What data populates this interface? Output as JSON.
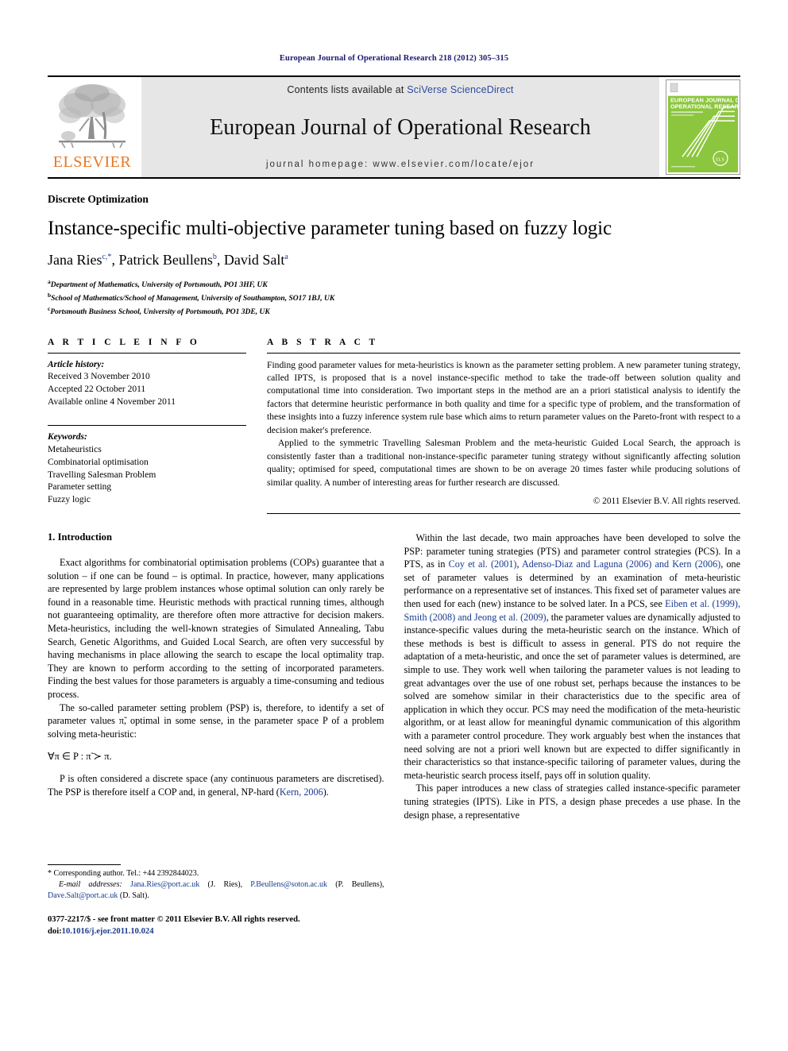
{
  "running_head": "European Journal of Operational Research 218 (2012) 305–315",
  "masthead": {
    "publisher_name": "ELSEVIER",
    "contents_prefix": "Contents lists available at ",
    "contents_link": "SciVerse ScienceDirect",
    "journal_title": "European Journal of Operational Research",
    "homepage": "journal homepage: www.elsevier.com/locate/ejor",
    "cover_title_line1": "EUROPEAN JOURNAL OF",
    "cover_title_line2": "OPERATIONAL RESEARCH",
    "cover_logo": "ELSEVIER",
    "accent_orange": "#E87722",
    "cover_green": "#8cc63e",
    "link_blue": "#2e4a9e"
  },
  "article": {
    "section_label": "Discrete Optimization",
    "title": "Instance-specific multi-objective parameter tuning based on fuzzy logic",
    "authors": [
      {
        "name": "Jana Ries",
        "marker": "c,*"
      },
      {
        "name": "Patrick Beullens",
        "marker": "b"
      },
      {
        "name": "David Salt",
        "marker": "a"
      }
    ],
    "affiliations": [
      {
        "marker": "a",
        "text": "Department of Mathematics, University of Portsmouth, PO1 3HF, UK"
      },
      {
        "marker": "b",
        "text": "School of Mathematics/School of Management, University of Southampton, SO17 1BJ, UK"
      },
      {
        "marker": "c",
        "text": "Portsmouth Business School, University of Portsmouth, PO1 3DE, UK"
      }
    ]
  },
  "article_info": {
    "heading": "A R T I C L E   I N F O",
    "history_label": "Article history:",
    "history": [
      "Received 3 November 2010",
      "Accepted 22 October 2011",
      "Available online 4 November 2011"
    ],
    "keywords_label": "Keywords:",
    "keywords": [
      "Metaheuristics",
      "Combinatorial optimisation",
      "Travelling Salesman Problem",
      "Parameter setting",
      "Fuzzy logic"
    ]
  },
  "abstract": {
    "heading": "A B S T R A C T",
    "paragraphs": [
      "Finding good parameter values for meta-heuristics is known as the parameter setting problem. A new parameter tuning strategy, called IPTS, is proposed that is a novel instance-specific method to take the trade-off between solution quality and computational time into consideration. Two important steps in the method are an a priori statistical analysis to identify the factors that determine heuristic performance in both quality and time for a specific type of problem, and the transformation of these insights into a fuzzy inference system rule base which aims to return parameter values on the Pareto-front with respect to a decision maker's preference.",
      "Applied to the symmetric Travelling Salesman Problem and the meta-heuristic Guided Local Search, the approach is consistently faster than a traditional non-instance-specific parameter tuning strategy without significantly affecting solution quality; optimised for speed, computational times are shown to be on average 20 times faster while producing solutions of similar quality. A number of interesting areas for further research are discussed."
    ],
    "copyright": "© 2011 Elsevier B.V. All rights reserved."
  },
  "introduction": {
    "heading": "1. Introduction",
    "left_paragraphs": [
      "Exact algorithms for combinatorial optimisation problems (COPs) guarantee that a solution – if one can be found – is optimal. In practice, however, many applications are represented by large problem instances whose optimal solution can only rarely be found in a reasonable time. Heuristic methods with practical running times, although not guaranteeing optimality, are therefore often more attractive for decision makers. Meta-heuristics, including the well-known strategies of Simulated Annealing, Tabu Search, Genetic Algorithms, and Guided Local Search, are often very successful by having mechanisms in place allowing the search to escape the local optimality trap. They are known to perform according to the setting of incorporated parameters. Finding the best values for those parameters is arguably a time-consuming and tedious process.",
      "The so-called parameter setting problem (PSP) is, therefore, to identify a set of parameter values π̃, optimal in some sense, in the parameter space P of a problem solving meta-heuristic:"
    ],
    "equation": "∀π ∈ P : π̃ ≻ π.",
    "left_after_equation": "P is often considered a discrete space (any continuous parameters are discretised). The PSP is therefore itself a COP and, in general, NP-hard (Kern, 2006).",
    "right_paragraphs": [
      "Within the last decade, two main approaches have been developed to solve the PSP: parameter tuning strategies (PTS) and parameter control strategies (PCS). In a PTS, as in Coy et al. (2001), Adenso-Diaz and Laguna (2006) and Kern (2006), one set of parameter values is determined by an examination of meta-heuristic performance on a representative set of instances. This fixed set of parameter values are then used for each (new) instance to be solved later. In a PCS, see Eiben et al. (1999), Smith (2008) and Jeong et al. (2009), the parameter values are dynamically adjusted to instance-specific values during the meta-heuristic search on the instance. Which of these methods is best is difficult to assess in general. PTS do not require the adaptation of a meta-heuristic, and once the set of parameter values is determined, are simple to use. They work well when tailoring the parameter values is not leading to great advantages over the use of one robust set, perhaps because the instances to be solved are somehow similar in their characteristics due to the specific area of application in which they occur. PCS may need the modification of the meta-heuristic algorithm, or at least allow for meaningful dynamic communication of this algorithm with a parameter control procedure. They work arguably best when the instances that need solving are not a priori well known but are expected to differ significantly in their characteristics so that instance-specific tailoring of parameter values, during the meta-heuristic search process itself, pays off in solution quality.",
      "This paper introduces a new class of strategies called instance-specific parameter tuning strategies (IPTS). Like in PTS, a design phase precedes a use phase. In the design phase, a representative"
    ],
    "inline_refs_right": [
      "Coy et al. (2001)",
      "Adenso-Diaz and Laguna (2006) and Kern (2006)",
      "Eiben et al. (1999), Smith (2008) and Jeong et al. (2009)"
    ]
  },
  "footnotes": {
    "corresponding": "* Corresponding author. Tel.: +44 2392844023.",
    "email_label": "E-mail addresses:",
    "emails": [
      {
        "address": "Jana.Ries@port.ac.uk",
        "person": "(J. Ries)"
      },
      {
        "address": "P.Beullens@soton.ac.uk",
        "person": "(P. Beullens)"
      },
      {
        "address": "Dave.Salt@port.ac.uk",
        "person": "(D. Salt)"
      }
    ],
    "issn_line": "0377-2217/$ - see front matter © 2011 Elsevier B.V. All rights reserved.",
    "doi_label": "doi:",
    "doi_value": "10.1016/j.ejor.2011.10.024"
  }
}
